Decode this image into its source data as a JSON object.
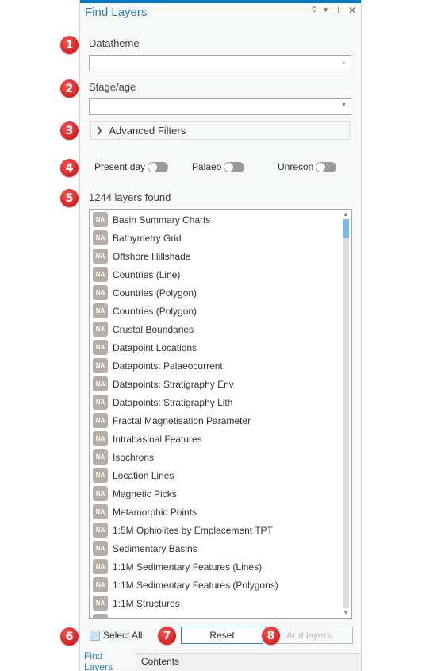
{
  "panel": {
    "title": "Find Layers",
    "controls": {
      "help": "?",
      "menu": "▼",
      "pin": "⊥",
      "close": "✕"
    }
  },
  "filters": {
    "datatheme": {
      "label": "Datatheme",
      "value": ""
    },
    "stage_age": {
      "label": "Stage/age",
      "value": ""
    },
    "advanced": {
      "label": "Advanced Filters",
      "expanded": false
    }
  },
  "toggles": [
    {
      "label": "Present day",
      "on": false
    },
    {
      "label": "Palaeo",
      "on": false
    },
    {
      "label": "Unrecon",
      "on": false
    }
  ],
  "results": {
    "count_text": "1244 layers found",
    "badge_text": "NA",
    "items": [
      "Basin Summary Charts",
      "Bathymetry Grid",
      "Offshore Hillshade",
      "Countries (Line)",
      "Countries (Polygon)",
      "Countries (Polygon)",
      "Crustal Boundaries",
      "Datapoint Locations",
      "Datapoints: Palaeocurrent",
      "Datapoints: Stratigraphy Env",
      "Datapoints: Stratigraphy Lith",
      "Fractal Magnetisation Parameter",
      "Intrabasinal Features",
      "Isochrons",
      "Location Lines",
      "Magnetic Picks",
      "Metamorphic Points",
      "1:5M Ophiolites by Emplacement TPT",
      "Sedimentary Basins",
      "1:1M Sedimentary Features (Lines)",
      "1:1M Sedimentary Features (Polygons)",
      "1:1M Structures",
      ""
    ]
  },
  "footer": {
    "select_all_label": "Select All",
    "reset_label": "Reset",
    "add_layers_label": "Add layers"
  },
  "tabs": [
    {
      "label": "Find Layers",
      "active": true
    },
    {
      "label": "Contents",
      "active": false
    }
  ],
  "callouts": [
    "1",
    "2",
    "3",
    "4",
    "5",
    "6",
    "7",
    "8"
  ],
  "colors": {
    "accent": "#0079c1",
    "title": "#2b7cd3",
    "callout": "#d81e1e",
    "badge": "#b8aca6",
    "scroll_thumb": "#7ab8e6"
  }
}
